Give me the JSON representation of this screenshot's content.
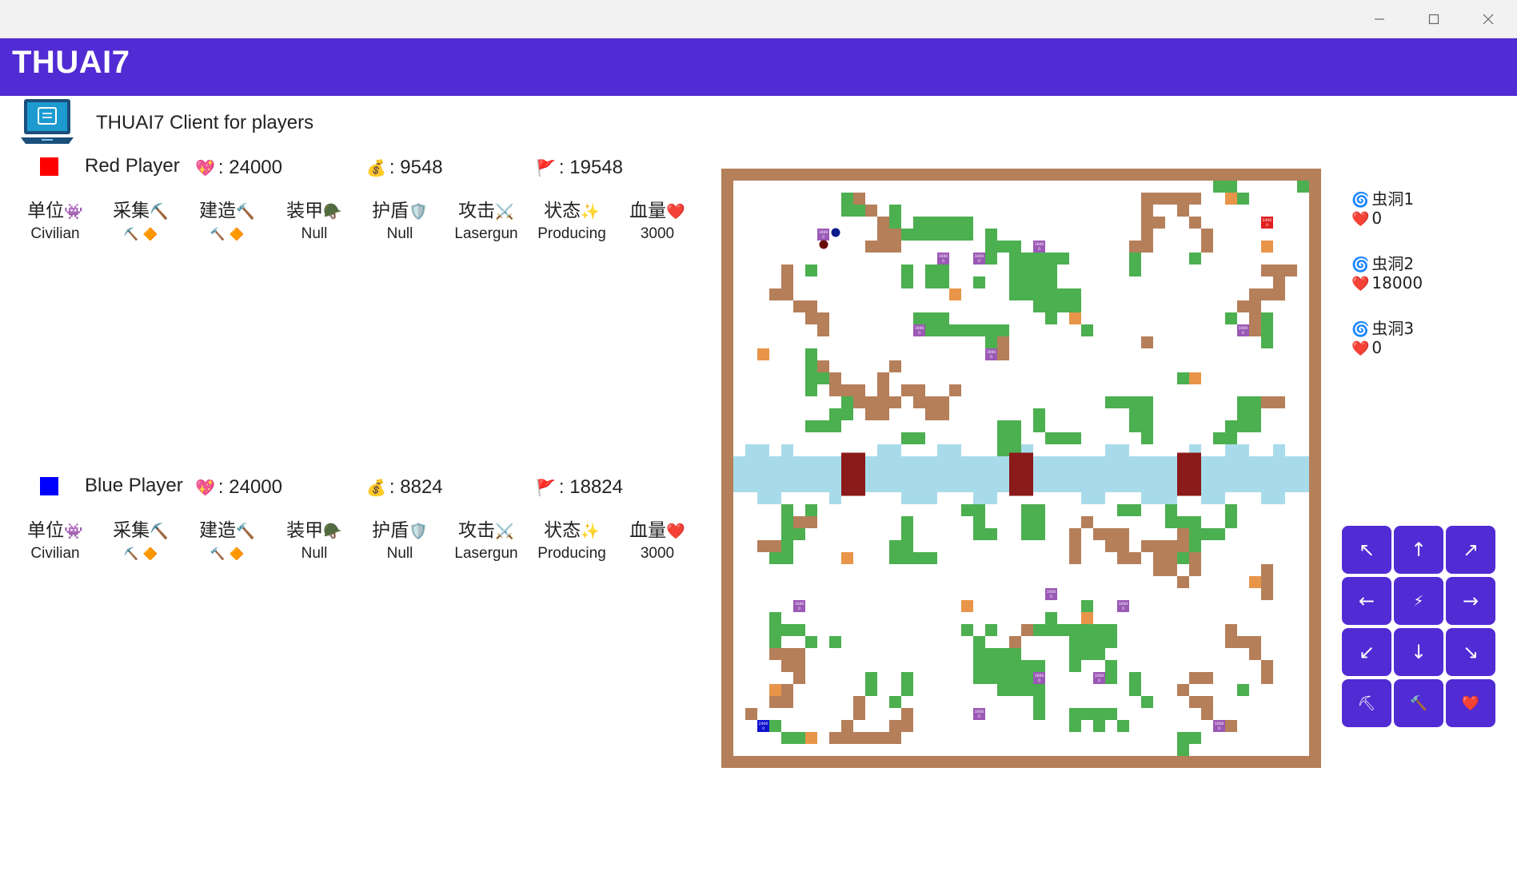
{
  "window": {
    "minimize": "—",
    "maximize": "▢",
    "close": "✕"
  },
  "app": {
    "title": "THUAI7",
    "subtitle": "THUAI7 Client for players"
  },
  "colors": {
    "accent": "#512bd4",
    "red_player": "#ff0000",
    "blue_player": "#0000ff",
    "dirt": "#b57f5a",
    "grass": "#4caf50",
    "water": "#a8dbea",
    "base": "#8b1a1a",
    "resource": "#e8954a",
    "construction": "#9b59b6"
  },
  "icons": {
    "hp": "💖",
    "money": "💰",
    "score": "🚩",
    "unit": "👾",
    "collect": "⛏️",
    "build": "🔨",
    "armor": "🪖",
    "shield": "🛡️",
    "attack": "⚔️",
    "state": "✨",
    "health": "❤️",
    "wormhole": "🌀",
    "diamond": "🔶"
  },
  "headers": {
    "unit": "单位",
    "collect": "采集",
    "build": "建造",
    "armor": "装甲",
    "shield": "护盾",
    "attack": "攻击",
    "state": "状态",
    "health": "血量"
  },
  "players": {
    "red": {
      "name": "Red Player",
      "hp": ": 24000",
      "money": ": 9548",
      "score": ": 19548",
      "ship": {
        "unit": "Civilian",
        "armor": "Null",
        "shield": "Null",
        "attack": "Lasergun",
        "state": "Producing",
        "health": "3000"
      }
    },
    "blue": {
      "name": "Blue Player",
      "hp": ": 24000",
      "money": ": 8824",
      "score": ": 18824",
      "ship": {
        "unit": "Civilian",
        "armor": "Null",
        "shield": "Null",
        "attack": "Lasergun",
        "state": "Producing",
        "health": "3000"
      }
    }
  },
  "wormholes": [
    {
      "name": "虫洞1",
      "hp": "0"
    },
    {
      "name": "虫洞2",
      "hp": "18000"
    },
    {
      "name": "虫洞3",
      "hp": "0"
    }
  ],
  "controls": {
    "up_left": "↖",
    "up": "↑",
    "up_right": "↗",
    "left": "←",
    "attack": "⚡",
    "right": "→",
    "down_left": "↙",
    "down": "↓",
    "down_right": "↘",
    "collect": "⛏",
    "build": "🔨",
    "recover": "❤️"
  },
  "map": {
    "construction_labels": [
      "1600",
      "0"
    ],
    "home_red_label": [
      "2400",
      "0"
    ],
    "home_blue_label": [
      "2400",
      "0"
    ]
  }
}
